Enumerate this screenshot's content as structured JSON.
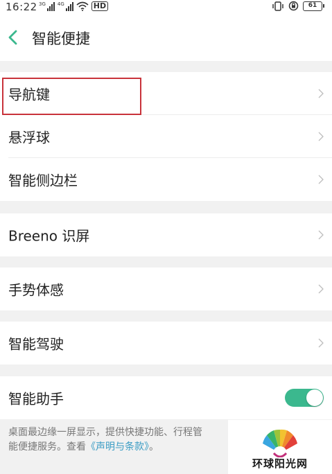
{
  "status_bar": {
    "time": "16:22",
    "signal1_label": "3G",
    "signal2_label": "4G",
    "hd_label": "HD",
    "battery": "61"
  },
  "header": {
    "title": "智能便捷",
    "back_icon": "chevron-left-icon",
    "accent_color": "#3bb88e"
  },
  "groups": [
    {
      "items": [
        {
          "label": "导航键"
        },
        {
          "label": "悬浮球"
        },
        {
          "label": "智能侧边栏"
        }
      ]
    },
    {
      "items": [
        {
          "label": "Breeno 识屏"
        }
      ]
    },
    {
      "items": [
        {
          "label": "手势体感"
        }
      ]
    },
    {
      "items": [
        {
          "label": "智能驾驶"
        }
      ]
    },
    {
      "items": [
        {
          "label": "智能助手",
          "toggle_on": true
        }
      ]
    }
  ],
  "footer": {
    "line1": "桌面最边缘一屏显示，提供快捷功能、行程管",
    "line2_prefix": "能便捷服务。查看",
    "link": "《声明与条款》",
    "line2_suffix": "。"
  },
  "watermark": {
    "text": "环球阳光网"
  }
}
